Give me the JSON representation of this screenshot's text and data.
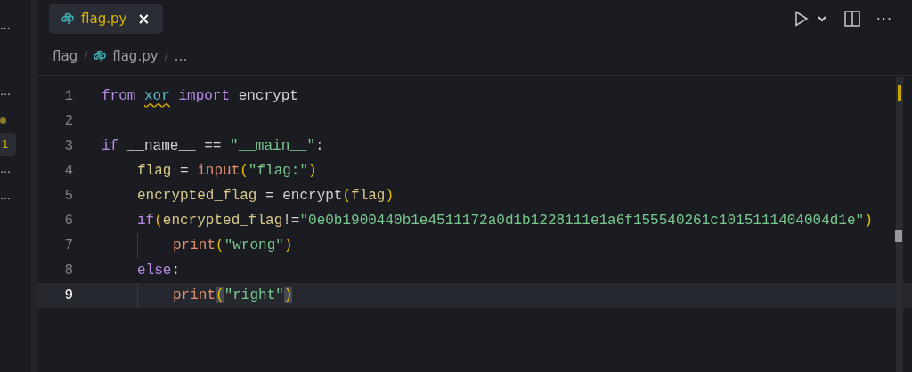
{
  "sidebar": {
    "items": [
      {
        "kind": "text",
        "label": "···"
      },
      {
        "kind": "text",
        "label": "…"
      },
      {
        "kind": "dot",
        "color": "#8a7a2a"
      },
      {
        "kind": "badge",
        "label": "1"
      },
      {
        "kind": "text",
        "label": "…"
      },
      {
        "kind": "text",
        "label": "…"
      }
    ]
  },
  "tabs": [
    {
      "label": "flag.py",
      "selected": true,
      "close": "×"
    }
  ],
  "toolbar": {
    "more": "···"
  },
  "breadcrumb": {
    "folder": "flag",
    "file": "flag.py",
    "rest": "…",
    "separator": "/"
  },
  "lines": [
    {
      "number": "1",
      "current": false,
      "tokens": [
        {
          "kind": "kw",
          "text": "from "
        },
        {
          "kind": "mod",
          "text": "xor",
          "warning": true
        },
        {
          "kind": "kw",
          "text": " import"
        },
        {
          "kind": "plain",
          "text": " encrypt"
        }
      ]
    },
    {
      "number": "2",
      "current": false
    },
    {
      "number": "3",
      "current": false,
      "tokens": [
        {
          "kind": "kw",
          "text": "if"
        },
        {
          "kind": "plain",
          "text": " __name__ == "
        },
        {
          "kind": "str",
          "text": "\"__main__\""
        },
        {
          "kind": "plain",
          "text": ":"
        }
      ],
      "children": [
        {
          "number": "4",
          "current": false,
          "tokens": [
            {
              "kind": "var",
              "text": "flag"
            },
            {
              "kind": "plain",
              "text": " = "
            },
            {
              "kind": "fn",
              "text": "input"
            },
            {
              "kind": "paren",
              "text": "("
            },
            {
              "kind": "str",
              "text": "\"flag:\""
            },
            {
              "kind": "paren",
              "text": ")"
            }
          ]
        },
        {
          "number": "5",
          "current": false,
          "tokens": [
            {
              "kind": "var",
              "text": "encrypted_flag"
            },
            {
              "kind": "plain",
              "text": " = encrypt"
            },
            {
              "kind": "paren",
              "text": "("
            },
            {
              "kind": "var",
              "text": "flag"
            },
            {
              "kind": "paren",
              "text": ")"
            }
          ]
        },
        {
          "number": "6",
          "current": false,
          "tokens": [
            {
              "kind": "kw",
              "text": "if"
            },
            {
              "kind": "paren",
              "text": "("
            },
            {
              "kind": "var",
              "text": "encrypted_flag"
            },
            {
              "kind": "plain",
              "text": "!="
            },
            {
              "kind": "str",
              "text": "\"0e0b1900440b1e4511172a0d1b1228111e1a6f155540261c1015111404004d1e\""
            },
            {
              "kind": "paren",
              "text": ")"
            }
          ],
          "children": [
            {
              "number": "7",
              "current": false,
              "tokens": [
                {
                  "kind": "fn",
                  "text": "print"
                },
                {
                  "kind": "paren",
                  "text": "("
                },
                {
                  "kind": "str",
                  "text": "\"wrong\""
                },
                {
                  "kind": "paren",
                  "text": ")"
                }
              ]
            }
          ]
        },
        {
          "number": "8",
          "current": false,
          "tokens": [
            {
              "kind": "kw",
              "text": "else"
            },
            {
              "kind": "plain",
              "text": ":"
            }
          ],
          "children": [
            {
              "number": "9",
              "current": true,
              "tokens": [
                {
                  "kind": "fn",
                  "text": "print"
                },
                {
                  "kind": "match",
                  "text": "("
                },
                {
                  "kind": "str",
                  "text": "\"right\""
                },
                {
                  "kind": "match",
                  "text": ")"
                }
              ]
            }
          ]
        }
      ]
    }
  ]
}
